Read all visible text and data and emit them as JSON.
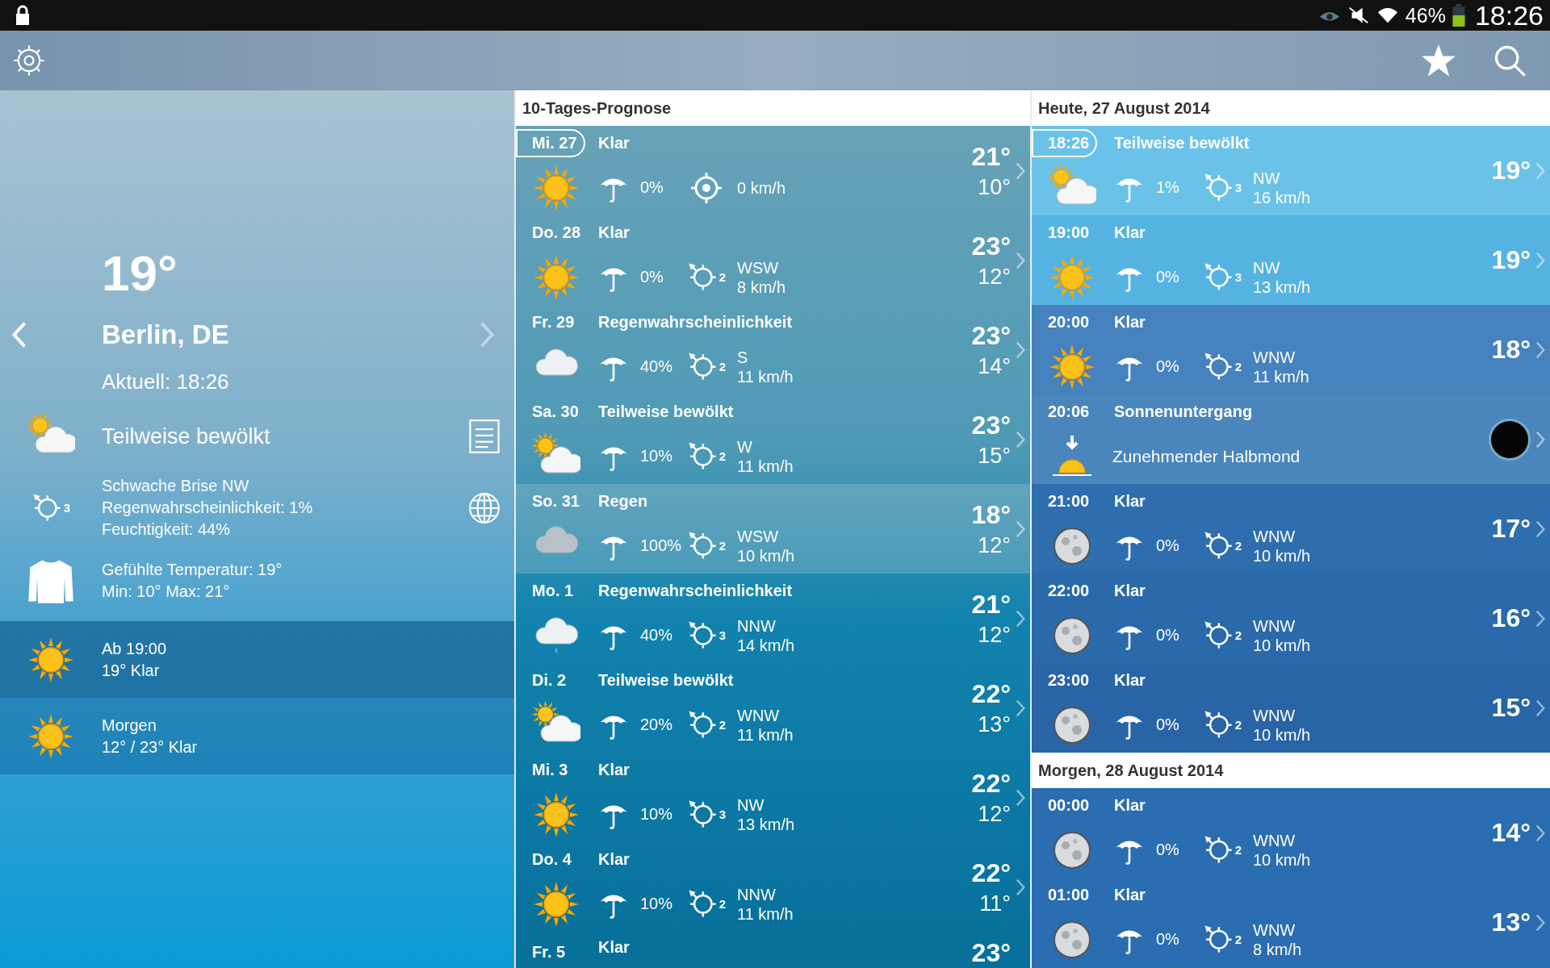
{
  "status_bar": {
    "battery": "46%",
    "time": "18:26"
  },
  "current": {
    "temp": "19°",
    "city": "Berlin, DE",
    "updated": "Aktuell: 18:26",
    "kind": "partly",
    "condition": "Teilweise bewölkt",
    "wind_force": "3",
    "details": [
      "Schwache Brise NW",
      "Regenwahrscheinlichkeit: 1%",
      "Feuchtigkeit: 44%"
    ],
    "feel": [
      "Gefühlte Temperatur: 19°",
      "Min: 10° Max: 21°"
    ],
    "outlook": [
      {
        "kind": "sun",
        "title": "Ab 19:00",
        "text": "19° Klar"
      },
      {
        "kind": "sun",
        "title": "Morgen",
        "text": "12° / 23° Klar"
      }
    ]
  },
  "forecast": {
    "title": "10-Tages-Prognose",
    "days": [
      {
        "day": "Mi. 27",
        "current": true,
        "condition": "Klar",
        "kind": "sun",
        "rain": "0%",
        "speed": "0 km/h",
        "high": "21°",
        "low": "10°"
      },
      {
        "day": "Do. 28",
        "current": false,
        "condition": "Klar",
        "kind": "sun",
        "rain": "0%",
        "force": "2",
        "direction": "WSW",
        "speed": "8 km/h",
        "high": "23°",
        "low": "12°"
      },
      {
        "day": "Fr. 29",
        "current": false,
        "condition": "Regenwahrscheinlichkeit",
        "kind": "showers",
        "rain": "40%",
        "force": "2",
        "direction": "S",
        "speed": "11 km/h",
        "high": "23°",
        "low": "14°"
      },
      {
        "day": "Sa. 30",
        "current": false,
        "condition": "Teilweise bewölkt",
        "kind": "partly",
        "rain": "10%",
        "force": "2",
        "direction": "W",
        "speed": "11 km/h",
        "high": "23°",
        "low": "15°"
      },
      {
        "day": "So. 31",
        "current": false,
        "condition": "Regen",
        "kind": "rain",
        "rain": "100%",
        "force": "2",
        "direction": "WSW",
        "speed": "10 km/h",
        "high": "18°",
        "low": "12°"
      },
      {
        "day": "Mo. 1",
        "current": false,
        "condition": "Regenwahrscheinlichkeit",
        "kind": "showers",
        "rain": "40%",
        "force": "3",
        "direction": "NNW",
        "speed": "14 km/h",
        "high": "21°",
        "low": "12°"
      },
      {
        "day": "Di. 2",
        "current": false,
        "condition": "Teilweise bewölkt",
        "kind": "partly",
        "rain": "20%",
        "force": "2",
        "direction": "WNW",
        "speed": "11 km/h",
        "high": "22°",
        "low": "13°"
      },
      {
        "day": "Mi. 3",
        "current": false,
        "condition": "Klar",
        "kind": "sun",
        "rain": "10%",
        "force": "3",
        "direction": "NW",
        "speed": "13 km/h",
        "high": "22°",
        "low": "12°"
      },
      {
        "day": "Do. 4",
        "current": false,
        "condition": "Klar",
        "kind": "sun",
        "rain": "10%",
        "force": "2",
        "direction": "NNW",
        "speed": "11 km/h",
        "high": "22°",
        "low": "11°"
      },
      {
        "day": "Fr. 5",
        "current": false,
        "condition": "Klar",
        "high": "23°"
      }
    ]
  },
  "hourly": [
    {
      "heading": "Heute, 27 August 2014",
      "hours": [
        {
          "kind": "partly",
          "time": "18:26",
          "current": true,
          "condition": "Teilweise bewölkt",
          "rain": "1%",
          "force": "3",
          "direction": "NW",
          "speed": "16 km/h",
          "temp": "19°"
        },
        {
          "kind": "sun",
          "time": "19:00",
          "current": false,
          "condition": "Klar",
          "rain": "0%",
          "force": "3",
          "direction": "NW",
          "speed": "13 km/h",
          "temp": "19°"
        },
        {
          "kind": "sun",
          "time": "20:00",
          "current": false,
          "condition": "Klar",
          "rain": "0%",
          "force": "2",
          "direction": "WNW",
          "speed": "11 km/h",
          "temp": "18°"
        },
        {
          "kind": "sunset",
          "time": "20:06",
          "current": false,
          "condition": "Sonnenuntergang",
          "note": "Zunehmender Halbmond"
        },
        {
          "kind": "moon",
          "time": "21:00",
          "current": false,
          "condition": "Klar",
          "rain": "0%",
          "force": "2",
          "direction": "WNW",
          "speed": "10 km/h",
          "temp": "17°"
        },
        {
          "kind": "moon",
          "time": "22:00",
          "current": false,
          "condition": "Klar",
          "rain": "0%",
          "force": "2",
          "direction": "WNW",
          "speed": "10 km/h",
          "temp": "16°"
        },
        {
          "kind": "moon",
          "time": "23:00",
          "current": false,
          "condition": "Klar",
          "rain": "0%",
          "force": "2",
          "direction": "WNW",
          "speed": "10 km/h",
          "temp": "15°"
        }
      ]
    },
    {
      "heading": "Morgen, 28 August 2014",
      "hours": [
        {
          "kind": "moon",
          "time": "00:00",
          "current": false,
          "condition": "Klar",
          "rain": "0%",
          "force": "2",
          "direction": "WNW",
          "speed": "10 km/h",
          "temp": "14°"
        },
        {
          "kind": "moon",
          "time": "01:00",
          "current": false,
          "condition": "Klar",
          "rain": "0%",
          "force": "2",
          "direction": "WNW",
          "speed": "8 km/h",
          "temp": "13°"
        }
      ]
    }
  ]
}
